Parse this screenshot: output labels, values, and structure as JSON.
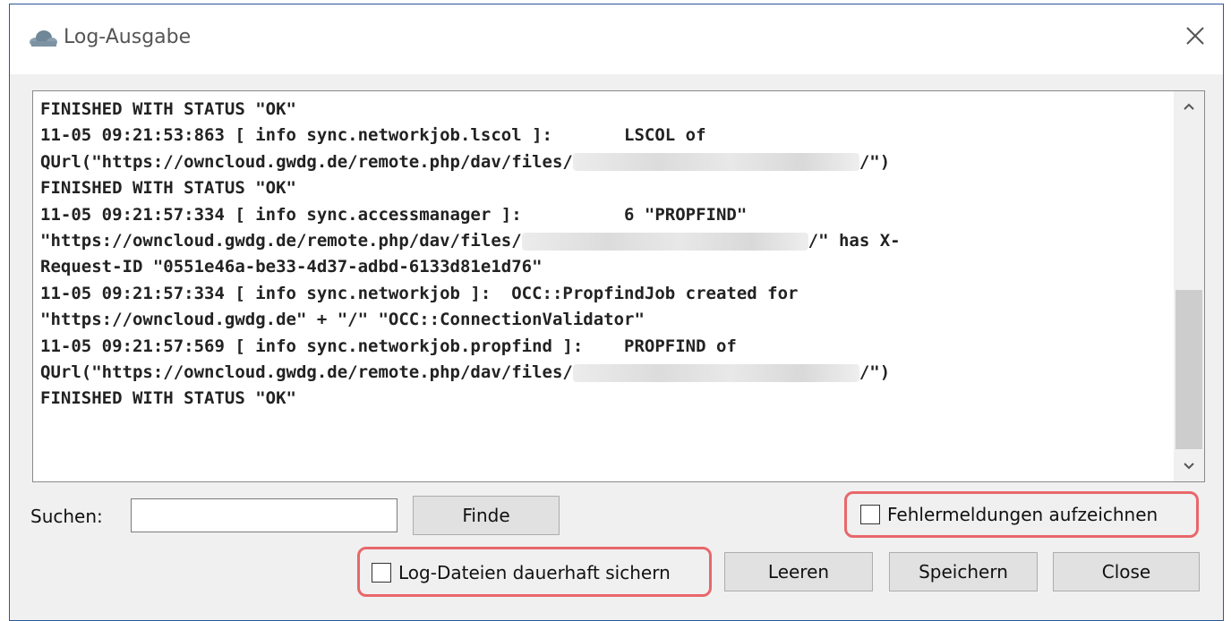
{
  "window": {
    "title": "Log-Ausgabe",
    "close_glyph": "✕"
  },
  "log": {
    "lines": [
      [
        "FINISHED WITH STATUS \"OK\""
      ],
      [
        "11-05 09:21:53:863 [ info sync.networkjob.lscol ]:       LSCOL of"
      ],
      [
        "QUrl(\"https://owncloud.gwdg.de/remote.php/dav/files/",
        "{blur}",
        "/\")"
      ],
      [
        "FINISHED WITH STATUS \"OK\""
      ],
      [
        "11-05 09:21:57:334 [ info sync.accessmanager ]:          6 \"PROPFIND\""
      ],
      [
        "\"https://owncloud.gwdg.de/remote.php/dav/files/",
        "{blur}",
        "/\" has X-"
      ],
      [
        "Request-ID \"0551e46a-be33-4d37-adbd-6133d81e1d76\""
      ],
      [
        "11-05 09:21:57:334 [ info sync.networkjob ]:  OCC::PropfindJob created for"
      ],
      [
        "\"https://owncloud.gwdg.de\" + \"/\" \"OCC::ConnectionValidator\""
      ],
      [
        "11-05 09:21:57:569 [ info sync.networkjob.propfind ]:    PROPFIND of"
      ],
      [
        "QUrl(\"https://owncloud.gwdg.de/remote.php/dav/files/",
        "{blur}",
        "/\")"
      ],
      [
        "FINISHED WITH STATUS \"OK\""
      ]
    ]
  },
  "search": {
    "label": "Suchen:",
    "value": "",
    "placeholder": "",
    "find_label": "Finde"
  },
  "options": {
    "record_errors_label": "Fehlermeldungen aufzeichnen",
    "record_errors_checked": false,
    "keep_logs_label": "Log-Dateien dauerhaft sichern",
    "keep_logs_checked": false
  },
  "buttons": {
    "clear_label": "Leeren",
    "save_label": "Speichern",
    "close_label": "Close"
  },
  "colors": {
    "highlight": "#e8676b",
    "window_border": "#2b5797"
  },
  "icons": {
    "app": "owncloud-cloud-icon",
    "close": "close-icon",
    "scroll_up": "chevron-up-icon",
    "scroll_down": "chevron-down-icon"
  }
}
